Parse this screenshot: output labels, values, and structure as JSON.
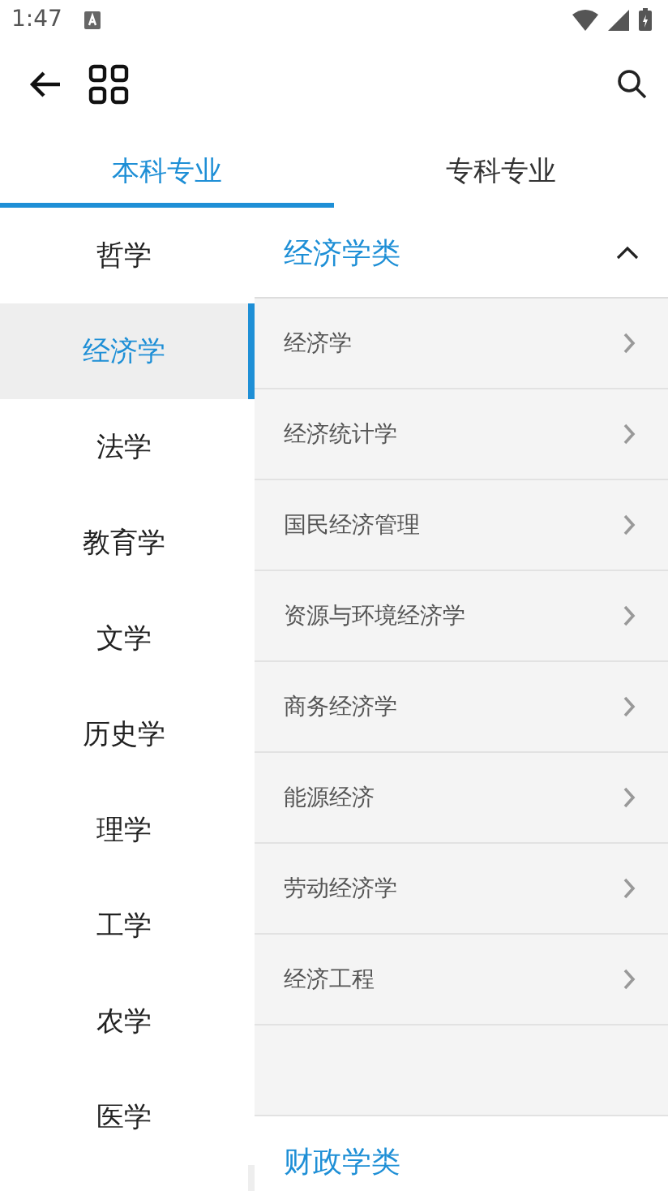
{
  "status_bar": {
    "time": "1:47"
  },
  "tabs": [
    {
      "label": "本科专业",
      "selected": true
    },
    {
      "label": "专科专业",
      "selected": false
    }
  ],
  "sidebar": {
    "items": [
      {
        "label": "哲学",
        "selected": false
      },
      {
        "label": "经济学",
        "selected": true
      },
      {
        "label": "法学",
        "selected": false
      },
      {
        "label": "教育学",
        "selected": false
      },
      {
        "label": "文学",
        "selected": false
      },
      {
        "label": "历史学",
        "selected": false
      },
      {
        "label": "理学",
        "selected": false
      },
      {
        "label": "工学",
        "selected": false
      },
      {
        "label": "农学",
        "selected": false
      },
      {
        "label": "医学",
        "selected": false
      }
    ]
  },
  "groups": [
    {
      "title": "经济学类",
      "expanded": true,
      "items": [
        "经济学",
        "经济统计学",
        "国民经济管理",
        "资源与环境经济学",
        "商务经济学",
        "能源经济",
        "劳动经济学",
        "经济工程"
      ]
    },
    {
      "title": "财政学类"
    }
  ]
}
